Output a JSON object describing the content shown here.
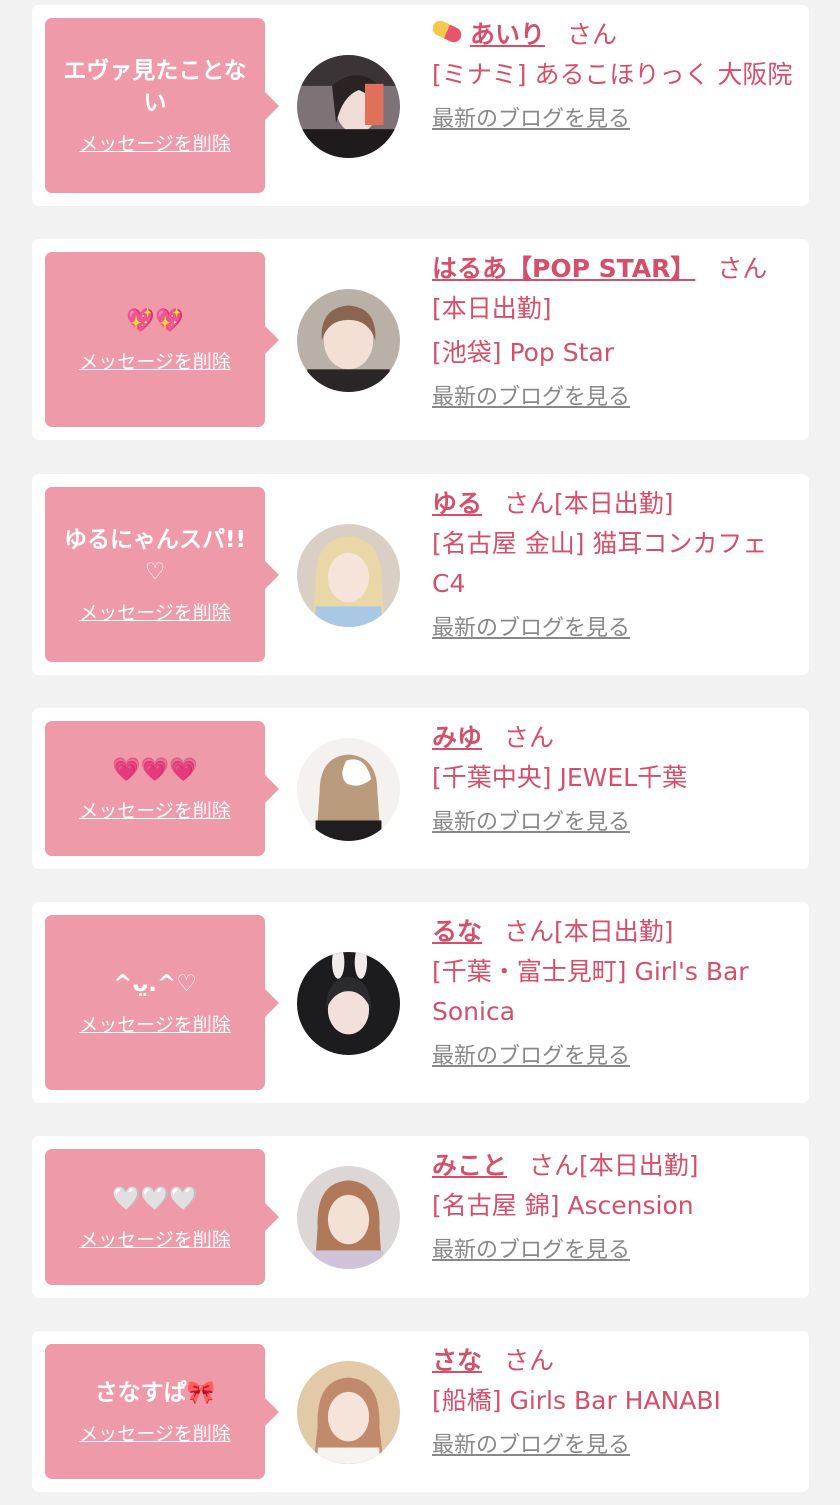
{
  "delete_label": "メッセージを削除",
  "san_label": "さん",
  "blog_label": "最新のブログを見る",
  "colors": {
    "bubble": "#ee9aa9",
    "accent": "#d64f6a",
    "link_gray": "#888888",
    "page_bg": "#f2f2f2"
  },
  "cards": [
    {
      "message": "エヴァ見たことない",
      "name": "あいり",
      "name_icon": "pill-icon",
      "status": "",
      "shop": "[ミナミ] あるこほりっく 大阪院"
    },
    {
      "message": "💖💖",
      "name": "はるあ【POP STAR】",
      "status": "[本日出勤]",
      "shop": "[池袋] Pop Star"
    },
    {
      "message": "ゆるにゃんスパ!! ♡",
      "name": "ゆる",
      "status": "[本日出勤]",
      "shop": "[名古屋 金山] 猫耳コンカフェC4"
    },
    {
      "message": "💗💗💗",
      "name": "みゆ",
      "status": "",
      "shop": "[千葉中央] JEWEL千葉"
    },
    {
      "message": "^ᴗ̤.^♡",
      "name": "るな",
      "status": "[本日出勤]",
      "shop": "[千葉・富士見町] Girl's Bar Sonica"
    },
    {
      "message": "🤍🤍🤍",
      "name": "みこと",
      "status": "[本日出勤]",
      "shop": "[名古屋 錦] Ascension"
    },
    {
      "message": "さなすぱ🎀",
      "name": "さな",
      "status": "",
      "shop": "[船橋] Girls Bar HANABI"
    }
  ]
}
